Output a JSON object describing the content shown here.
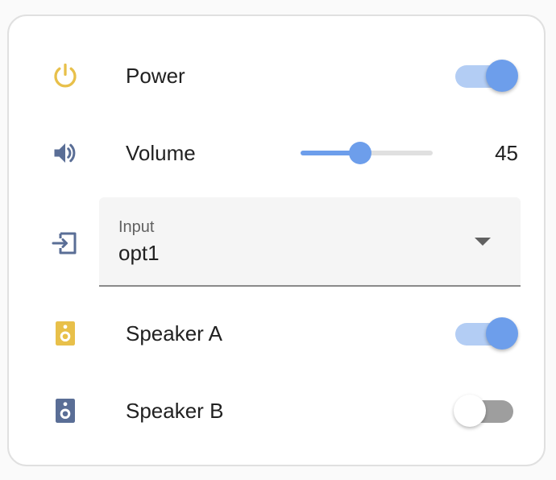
{
  "colors": {
    "accent": "#6d9eeb",
    "icon_on": "#e8c04a",
    "icon_off": "#5a6e96"
  },
  "power": {
    "label": "Power",
    "icon": "power-icon",
    "on": true
  },
  "volume": {
    "label": "Volume",
    "icon": "speaker-volume-icon",
    "value": "45",
    "level_percent": 45
  },
  "input": {
    "icon": "input-icon",
    "label": "Input",
    "value": "opt1"
  },
  "speaker_a": {
    "label": "Speaker A",
    "icon": "speaker-a-icon",
    "on": true
  },
  "speaker_b": {
    "label": "Speaker B",
    "icon": "speaker-b-icon",
    "on": false
  }
}
